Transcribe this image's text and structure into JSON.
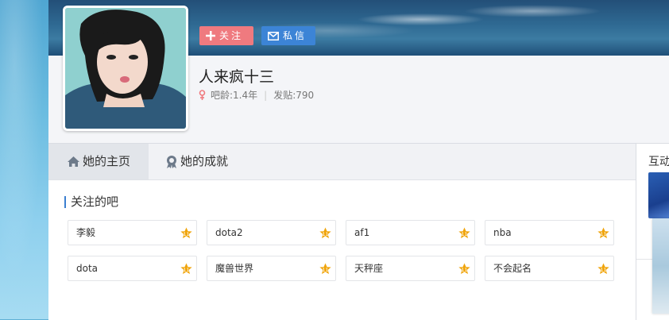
{
  "profile": {
    "username": "人来疯十三",
    "gender_icon": "female-icon",
    "gender_color": "#ef7a7f",
    "age_label": "吧龄:1.4年",
    "posts_label": "发贴:790",
    "meta_separator": "|"
  },
  "buttons": {
    "follow_label": "关注",
    "message_label": "私信"
  },
  "tabs": [
    {
      "label": "她的主页",
      "icon": "home-icon",
      "active": true
    },
    {
      "label": "她的成就",
      "icon": "achievement-icon",
      "active": false
    }
  ],
  "followed_bars": {
    "title": "关注的吧",
    "items": [
      "李毅",
      "dota2",
      "af1",
      "nba",
      "dota",
      "魔兽世界",
      "天秤座",
      "不会起名"
    ]
  },
  "sidebar": {
    "title": "互动"
  },
  "colors": {
    "accent_blue": "#3c84d6",
    "follow_red": "#ef7a7f",
    "star_gold": "#f0a40a"
  }
}
